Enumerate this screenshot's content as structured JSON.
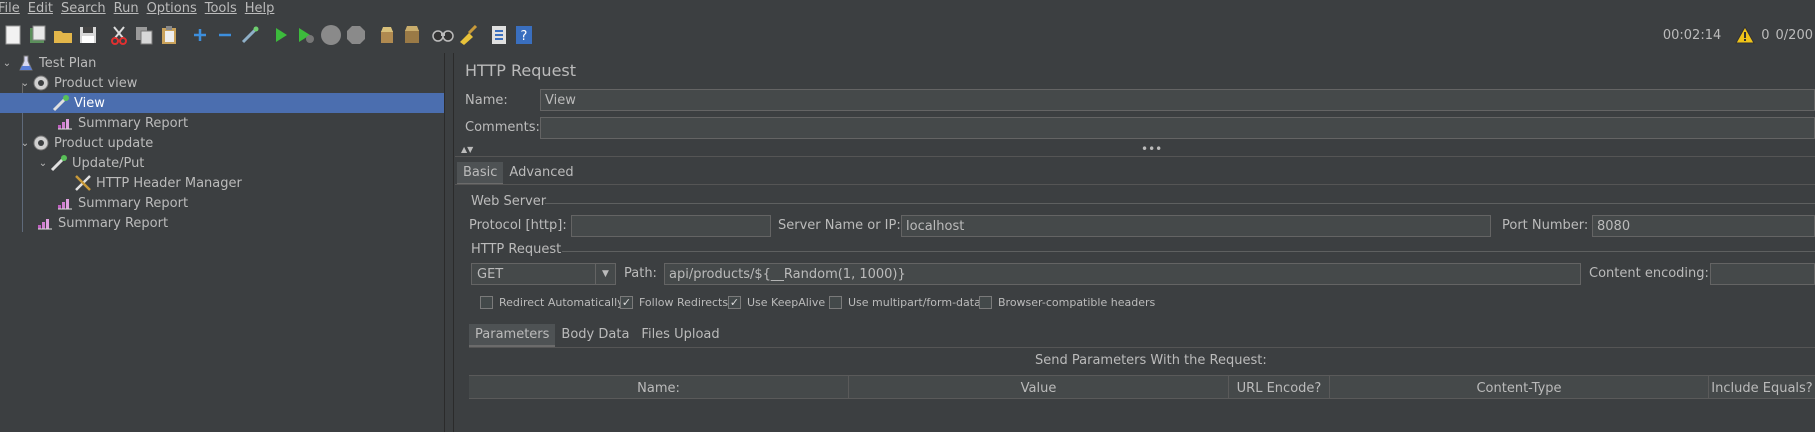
{
  "menu": [
    "File",
    "Edit",
    "Search",
    "Run",
    "Options",
    "Tools",
    "Help"
  ],
  "toolbar": {
    "icons": [
      "new-icon",
      "templates-icon",
      "open-icon",
      "save-icon",
      "cut-icon",
      "copy-icon",
      "paste-icon",
      "expand-icon",
      "collapse-icon",
      "toggle-icon",
      "start-icon",
      "start-no-pauses-icon",
      "stop-icon",
      "shutdown-icon",
      "clear-icon",
      "clear-all-icon",
      "search-icon",
      "reset-search-icon",
      "function-helper-icon",
      "help-icon"
    ],
    "elapsed": "00:02:14",
    "warnings": "0",
    "threads": "0/200"
  },
  "tree": {
    "items": [
      {
        "label": "Test Plan",
        "icon": "test-plan-icon",
        "expanded": true
      },
      {
        "label": "Product view",
        "icon": "thread-group-icon",
        "expanded": true
      },
      {
        "label": "View",
        "icon": "http-sampler-icon",
        "selected": true
      },
      {
        "label": "Summary Report",
        "icon": "report-icon"
      },
      {
        "label": "Product update",
        "icon": "thread-group-icon",
        "expanded": true
      },
      {
        "label": "Update/Put",
        "icon": "http-sampler-icon",
        "expanded": true
      },
      {
        "label": "HTTP Header Manager",
        "icon": "config-icon"
      },
      {
        "label": "Summary Report",
        "icon": "report-icon"
      },
      {
        "label": "Summary Report",
        "icon": "report-icon"
      }
    ]
  },
  "panel": {
    "title": "HTTP Request",
    "name_label": "Name:",
    "name_value": "View",
    "comments_label": "Comments:",
    "comments_value": "",
    "tabs": [
      "Basic",
      "Advanced"
    ],
    "web_server": {
      "heading": "Web Server",
      "protocol_label": "Protocol [http]:",
      "protocol_value": "",
      "server_label": "Server Name or IP:",
      "server_value": "localhost",
      "port_label": "Port Number:",
      "port_value": "8080"
    },
    "http_request": {
      "heading": "HTTP Request",
      "method": "GET",
      "path_label": "Path:",
      "path_value": "api/products/${__Random(1, 1000)}",
      "encoding_label": "Content encoding:",
      "encoding_value": ""
    },
    "checkboxes": [
      {
        "label": "Redirect Automatically",
        "checked": false
      },
      {
        "label": "Follow Redirects",
        "checked": true
      },
      {
        "label": "Use KeepAlive",
        "checked": true
      },
      {
        "label": "Use multipart/form-data",
        "checked": false
      },
      {
        "label": "Browser-compatible headers",
        "checked": false
      }
    ],
    "sub_tabs": [
      "Parameters",
      "Body Data",
      "Files Upload"
    ],
    "params_caption": "Send Parameters With the Request:",
    "columns": [
      "Name:",
      "Value",
      "URL Encode?",
      "Content-Type",
      "Include Equals?"
    ]
  }
}
